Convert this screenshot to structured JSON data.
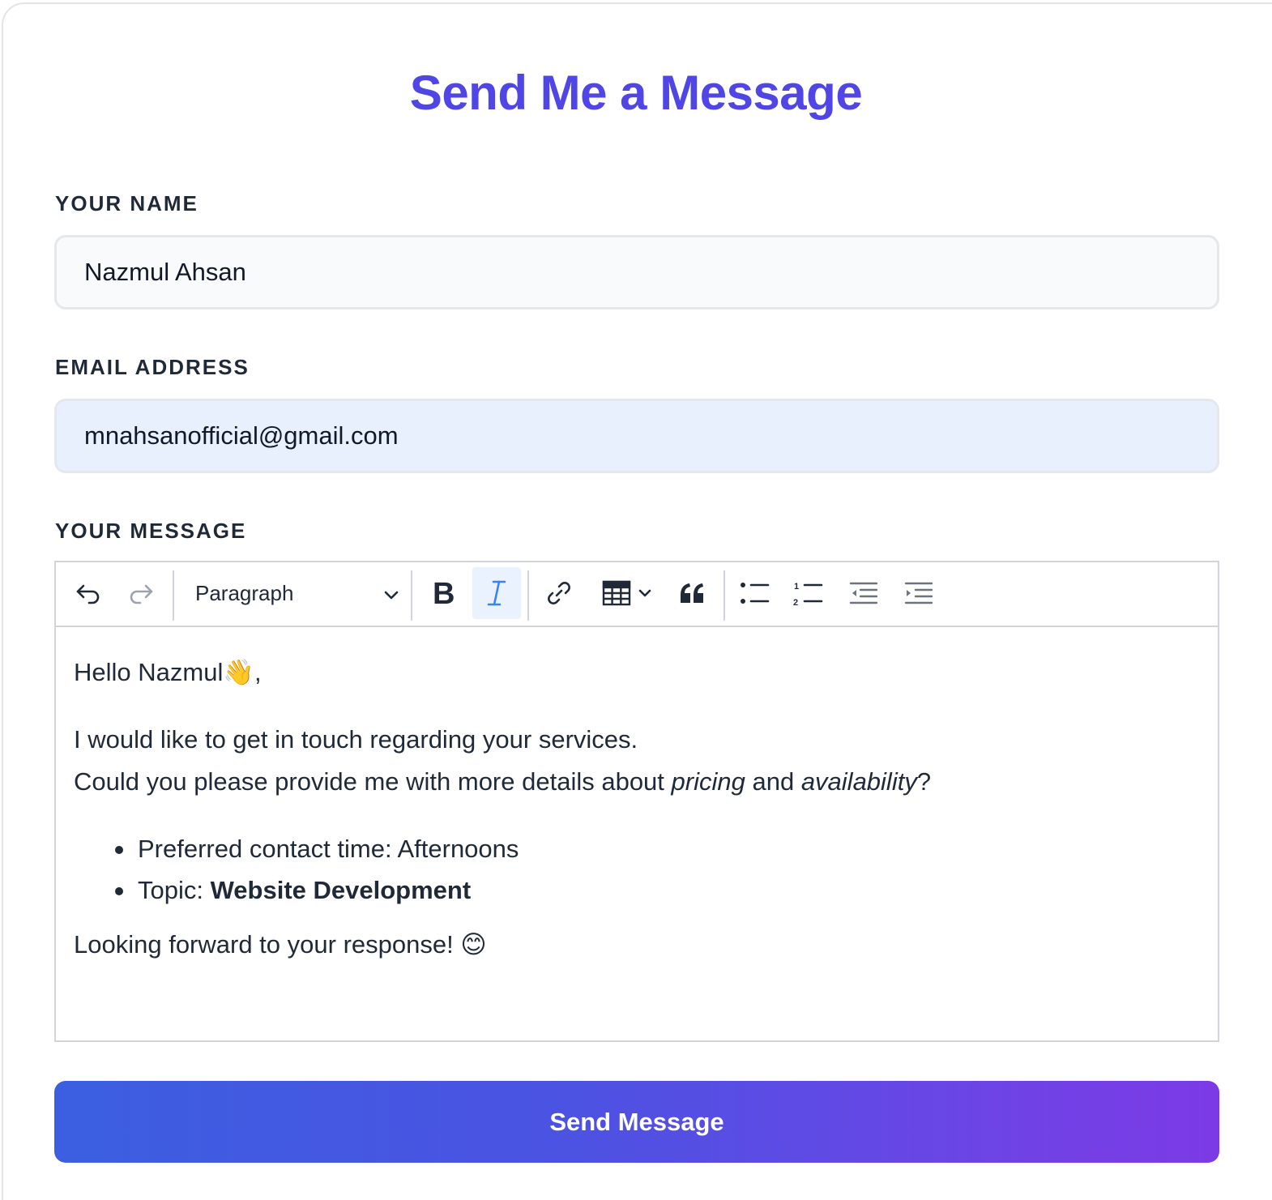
{
  "form": {
    "title": "Send Me a Message",
    "name_label": "YOUR NAME",
    "name_value": "Nazmul Ahsan",
    "email_label": "EMAIL ADDRESS",
    "email_value": "mnahsanofficial@gmail.com",
    "message_label": "YOUR MESSAGE",
    "submit_label": "Send Message"
  },
  "toolbar": {
    "paragraph_select": "Paragraph",
    "buttons": [
      "undo-icon",
      "redo-icon",
      "bold-icon",
      "italic-icon",
      "link-icon",
      "table-icon",
      "blockquote-icon",
      "bulleted-list-icon",
      "numbered-list-icon",
      "outdent-icon",
      "indent-icon"
    ],
    "active": "italic"
  },
  "message": {
    "greeting": "Hello Nazmul",
    "greeting_emoji": "👋",
    "greeting_punct": ",",
    "line1": "I would like to get in touch regarding your services.",
    "line2_a": "Could you please provide me with more details about ",
    "line2_pricing": "pricing",
    "line2_b": " and ",
    "line2_availability": "availability",
    "line2_c": "?",
    "bullet1": "Preferred contact time: Afternoons",
    "bullet2_prefix": "Topic: ",
    "bullet2_bold": "Website Development",
    "closing": "Looking forward to your response! ",
    "closing_emoji": "😊"
  },
  "colors": {
    "accent": "#4f46e5",
    "button_gradient_start": "#3b5fe0",
    "button_gradient_end": "#7c3ae6",
    "email_field_bg": "#e8effd",
    "active_tool_bg": "#eaf2fd",
    "active_tool_icon": "#3b82f6"
  }
}
